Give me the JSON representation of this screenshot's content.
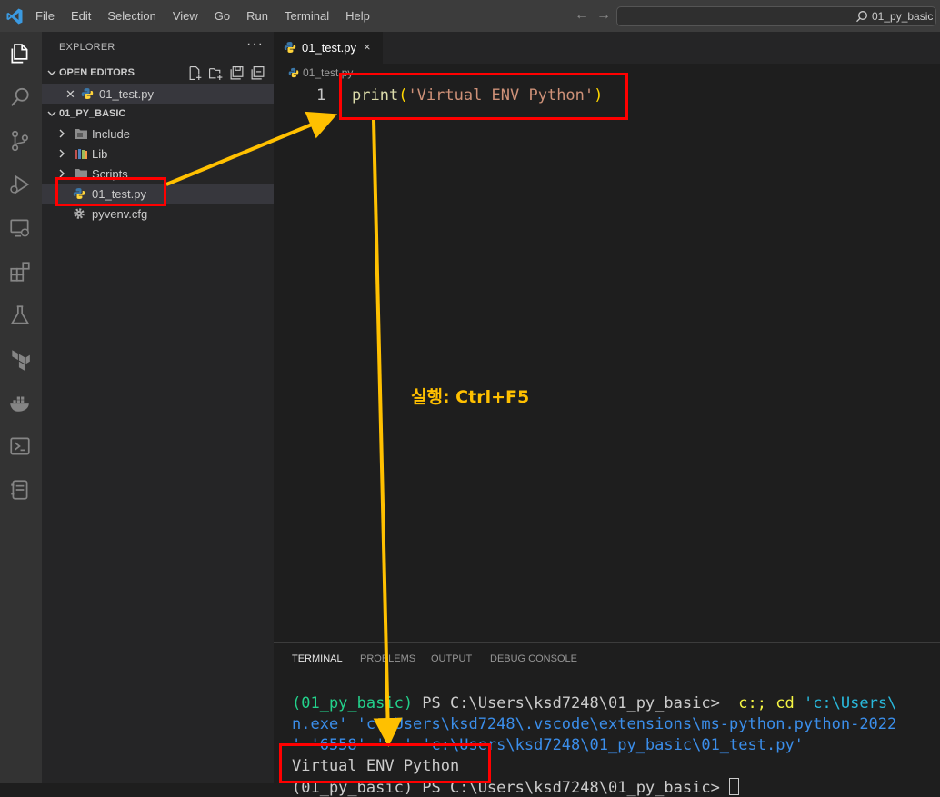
{
  "menu": [
    "File",
    "Edit",
    "Selection",
    "View",
    "Go",
    "Run",
    "Terminal",
    "Help"
  ],
  "command_center": {
    "text": "01_py_basic"
  },
  "activity_bar": [
    "explorer-icon",
    "search-icon",
    "source-control-icon",
    "run-debug-icon",
    "remote-explorer-icon",
    "extensions-icon",
    "testing-icon",
    "terraform-icon",
    "docker-icon",
    "powershell-icon",
    "notebook-icon"
  ],
  "explorer": {
    "title": "EXPLORER",
    "more": "···",
    "open_editors_label": "OPEN EDITORS",
    "open_editors": [
      {
        "name": "01_test.py"
      }
    ],
    "folder_label": "01_PY_BASIC",
    "tree": [
      {
        "name": "Include",
        "kind": "folder"
      },
      {
        "name": "Lib",
        "kind": "folder"
      },
      {
        "name": "Scripts",
        "kind": "folder"
      },
      {
        "name": "01_test.py",
        "kind": "python"
      },
      {
        "name": "pyvenv.cfg",
        "kind": "gear"
      }
    ]
  },
  "editor": {
    "tab_label": "01_test.py",
    "tab_close": "×",
    "breadcrumb": "01_test.py",
    "line_number": "1",
    "code": {
      "fn": "print",
      "open": "(",
      "str": "'Virtual ENV Python'",
      "close": ")"
    }
  },
  "panel": {
    "tabs": [
      "TERMINAL",
      "PROBLEMS",
      "OUTPUT",
      "DEBUG CONSOLE"
    ],
    "active_tab": "TERMINAL",
    "lines": {
      "l1_env": "(01_py_basic)",
      "l1_prompt": " PS C:\\Users\\ksd7248\\01_py_basic> ",
      "l1_cmd": " c:; cd ",
      "l1_path": "'c:\\Users\\",
      "l2": "n.exe' 'c:\\Users\\ksd7248\\.vscode\\extensions\\ms-python.python-2022",
      "l3": "' '6558' '--' 'c:\\Users\\ksd7248\\01_py_basic\\01_test.py'",
      "l4": "Virtual ENV Python",
      "l5": "(01_py_basic) PS C:\\Users\\ksd7248\\01_py_basic> "
    }
  },
  "annotation": {
    "text": "실행: Ctrl+F5",
    "color": "#ffc000"
  },
  "colors": {
    "highlight_box": "#ff0000",
    "arrow": "#ffc000",
    "accent": "#007acc"
  }
}
